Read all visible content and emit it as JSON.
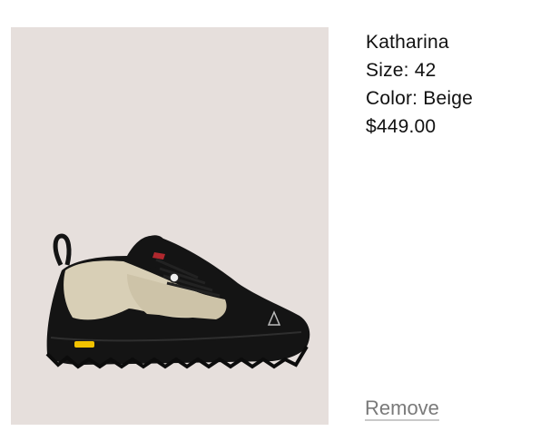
{
  "item": {
    "image_alt": "Katharina shoe",
    "name": "Katharina",
    "size": "Size: 42",
    "color": "Color: Beige",
    "price": "$449.00",
    "remove_label": "Remove",
    "sole_brand_text": "Vibram"
  },
  "colors": {
    "image_background": "#e6dfdc",
    "shoe_upper": "#d8cfb6",
    "shoe_black": "#141414",
    "sole_logo": "#f2c200",
    "remove_text": "#7a7a7a"
  },
  "icons": [
    "shoe-image",
    "roa-logo-icon",
    "vibram-logo-icon"
  ]
}
